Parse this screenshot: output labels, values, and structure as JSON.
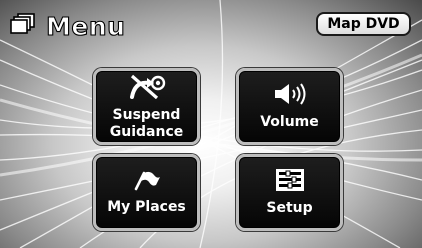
{
  "header": {
    "title": "Menu",
    "icon": "menu-windows-icon",
    "map_button_label": "Map DVD"
  },
  "menu": {
    "items": [
      {
        "label": "Suspend\nGuidance",
        "icon": "suspend-guidance-icon"
      },
      {
        "label": "Volume",
        "icon": "speaker-volume-icon"
      },
      {
        "label": "My Places",
        "icon": "flag-icon"
      },
      {
        "label": "Setup",
        "icon": "setup-list-icon"
      }
    ]
  },
  "colors": {
    "button_fill": "#0a0a0a",
    "button_border": "#bdbdbd",
    "title_text": "#ffffff"
  }
}
